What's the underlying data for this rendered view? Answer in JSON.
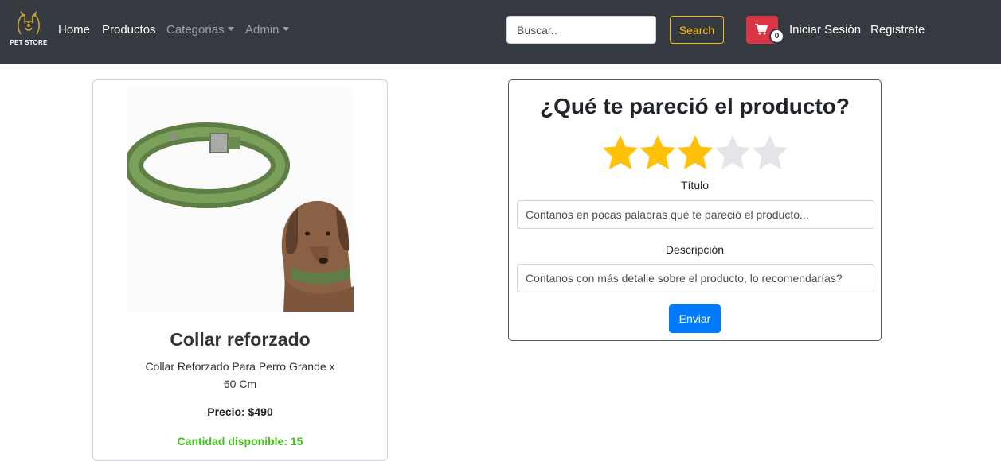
{
  "navbar": {
    "logo_text": "PET STORE",
    "links": {
      "home": "Home",
      "products": "Productos",
      "categories": "Categorias",
      "admin": "Admin"
    },
    "search": {
      "placeholder": "Buscar..",
      "button_label": "Search"
    },
    "cart": {
      "count": "0"
    },
    "login": "Iniciar Sesión",
    "register": "Registrate"
  },
  "product": {
    "title": "Collar reforzado",
    "description": "Collar Reforzado Para Perro Grande x 60 Cm",
    "price": "Precio: $490",
    "stock": "Cantidad disponible: 15"
  },
  "review": {
    "heading": "¿Qué te pareció el producto?",
    "rating": 3,
    "max_rating": 5,
    "title_label": "Título",
    "title_placeholder": "Contanos en pocas palabras qué te pareció el producto...",
    "description_label": "Descripción",
    "description_placeholder": "Contanos con más detalle sobre el producto, lo recomendarías?",
    "submit_label": "Enviar"
  },
  "colors": {
    "navbar_bg": "#343a40",
    "search_button": "#ffc107",
    "cart_button": "#dc3545",
    "star_filled": "#ffc107",
    "star_empty": "#e4e5e9",
    "stock_text": "#44c21d",
    "submit_button": "#007bff"
  },
  "icons": {
    "logo": "pet-store-logo-icon",
    "cart": "shopping-cart-icon",
    "caret": "caret-down-icon",
    "star": "star-icon"
  }
}
